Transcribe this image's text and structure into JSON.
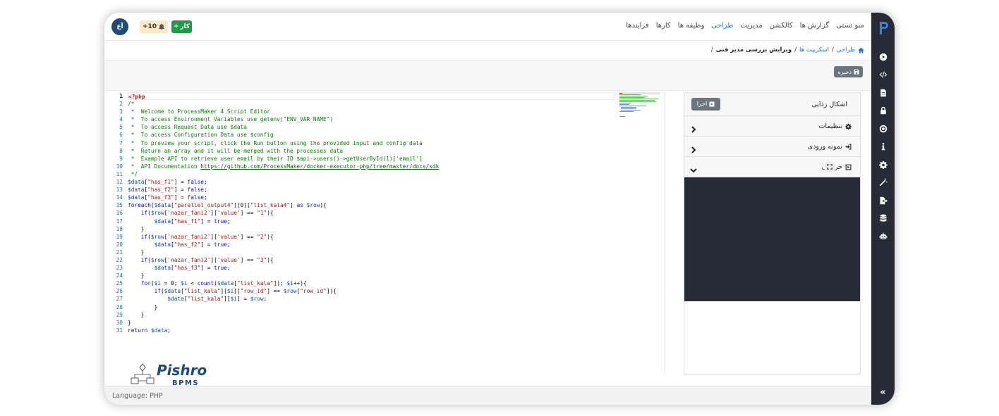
{
  "topbar": {
    "nav": [
      "فرایندها",
      "کارها",
      "وظیفه ها",
      "طراحی",
      "مدیریت",
      "کالکشن",
      "گزارش ها",
      "منو تستی"
    ],
    "active_nav": "طراحی",
    "notifications_count": "+10",
    "add_task_label": "کار",
    "avatar_initials": "آع"
  },
  "breadcrumb": {
    "home": "طراحی",
    "scripts": "اسکریپت ها",
    "current": "ویرایش بررسی مدیر فنی"
  },
  "toolbar": {
    "save_label": "ذخیره"
  },
  "editor": {
    "current_line": 1,
    "lines": [
      "<?php",
      "/*",
      " *  Welcome to ProcessMaker 4 Script Editor",
      " *  To access Environment Variables use getenv(\"ENV_VAR_NAME\")",
      " *  To access Request Data use $data",
      " *  To access Configuration Data use $config",
      " *  To preview your script, click the Run button using the provided input and config data",
      " *  Return an array and it will be merged with the processes data",
      " *  Example API to retrieve user email by their ID $api->users()->getUserById(1)['email']",
      " *  API Documentation https://github.com/ProcessMaker/docker-executor-php/tree/master/docs/sdk",
      " */",
      "$data[\"has_f1\"] = false;",
      "$data[\"has_f2\"] = false;",
      "$data[\"has_f3\"] = false;",
      "foreach($data[\"parallel_output4\"][0][\"list_kala4\"] as $row){",
      "    if($row['nazar_fani2']['value'] == \"1\"){",
      "        $data[\"has_f1\"] = true;",
      "    }",
      "    if($row['nazar_fani2']['value'] == \"2\"){",
      "        $data[\"has_f2\"] = true;",
      "    }",
      "    if($row['nazar_fani2']['value'] == \"3\"){",
      "        $data[\"has_f3\"] = true;",
      "    }",
      "    for($i = 0; $i < count($data[\"list_kala\"]); $i++){",
      "        if($data[\"list_kala\"][$i][\"row_id\"] == $row[\"row_id\"]){",
      "            $data[\"list_kala\"][$i] = $row;",
      "        }",
      "    }",
      "}",
      "return $data;"
    ]
  },
  "debug": {
    "title": "اشکال زدایی",
    "run_label": "اجرا",
    "settings_label": "تنظیمات",
    "sample_input_label": "نمونه ورودی",
    "output_label": "خروجی"
  },
  "brand": {
    "name": "Pishro",
    "sub": "BPMS"
  },
  "footer": {
    "language": "Language: PHP"
  },
  "sidebar": {
    "items": [
      "play-circle-icon",
      "code-icon",
      "file-icon",
      "lock-icon",
      "target-icon",
      "info-icon",
      "gear-icon",
      "magic-wand-icon",
      "file-export-icon",
      "database-icon",
      "robot-icon"
    ]
  },
  "colors": {
    "sidebar_bg": "#262b36",
    "accent": "#1a73d9",
    "add_button": "#1f9b46",
    "notif_bg": "#fbe8c4",
    "secondary_button": "#6c757d",
    "brand_blue": "#1e4a74"
  }
}
